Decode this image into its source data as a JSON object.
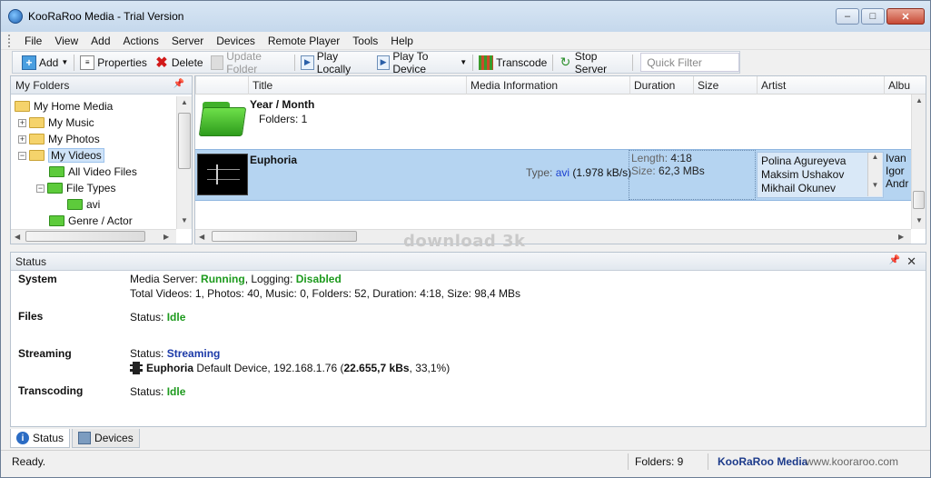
{
  "window": {
    "title": "KooRaRoo Media - Trial Version"
  },
  "menu": [
    "File",
    "View",
    "Add",
    "Actions",
    "Server",
    "Devices",
    "Remote Player",
    "Tools",
    "Help"
  ],
  "toolbar": {
    "add": "Add",
    "properties": "Properties",
    "delete": "Delete",
    "update_folder": "Update Folder",
    "play_locally": "Play Locally",
    "play_to_device": "Play To Device",
    "transcode": "Transcode",
    "stop_server": "Stop Server",
    "quick_filter_placeholder": "Quick Filter"
  },
  "folders_pane": {
    "title": "My Folders",
    "items": [
      "My Home Media",
      "My Music",
      "My Photos",
      "My Videos",
      "All Video Files",
      "File Types",
      "avi",
      "Genre / Actor"
    ]
  },
  "columns": [
    "Title",
    "Media Information",
    "Duration",
    "Size",
    "Artist",
    "Albu"
  ],
  "rows": [
    {
      "title": "Year / Month",
      "subtitle": "Folders: 1"
    },
    {
      "title": "Euphoria",
      "type_label": "Type:",
      "type_value": "avi",
      "bitrate": "(1.978 kB/s)",
      "length_label": "Length:",
      "length_value": "4:18",
      "size_label": "Size:",
      "size_value": "62,3 MBs",
      "artists": [
        "Polina Agureyeva",
        "Maksim Ushakov",
        "Mikhail Okunev"
      ],
      "album": [
        "Ivan",
        "Igor",
        "Andr"
      ]
    }
  ],
  "watermark": "download 3k",
  "status_pane": {
    "title": "Status",
    "system": {
      "label": "System",
      "ms_label": "Media Server:",
      "ms_value": "Running",
      "log_label": "Logging:",
      "log_value": "Disabled",
      "line2": "Total Videos: 1, Photos: 40, Music: 0, Folders: 52, Duration: 4:18, Size: 98,4 MBs"
    },
    "files": {
      "label": "Files",
      "status_label": "Status:",
      "status_value": "Idle"
    },
    "streaming": {
      "label": "Streaming",
      "status_label": "Status:",
      "status_value": "Streaming",
      "item_title": "Euphoria",
      "item_detail": "Default Device, 192.168.1.76 (",
      "item_rate": "22.655,7 kBs",
      "item_tail": ", 33,1%)"
    },
    "transcoding": {
      "label": "Transcoding",
      "status_label": "Status:",
      "status_value": "Idle"
    }
  },
  "tabs": [
    "Status",
    "Devices"
  ],
  "statusbar": {
    "ready": "Ready.",
    "folders": "Folders: 9",
    "brand": "KooRaRoo Media",
    "url": "www.kooraroo.com"
  },
  "colors": {
    "selection": "#b5d4f1",
    "accent_green": "#1d9a1d",
    "accent_blue": "#1c3aa8"
  }
}
